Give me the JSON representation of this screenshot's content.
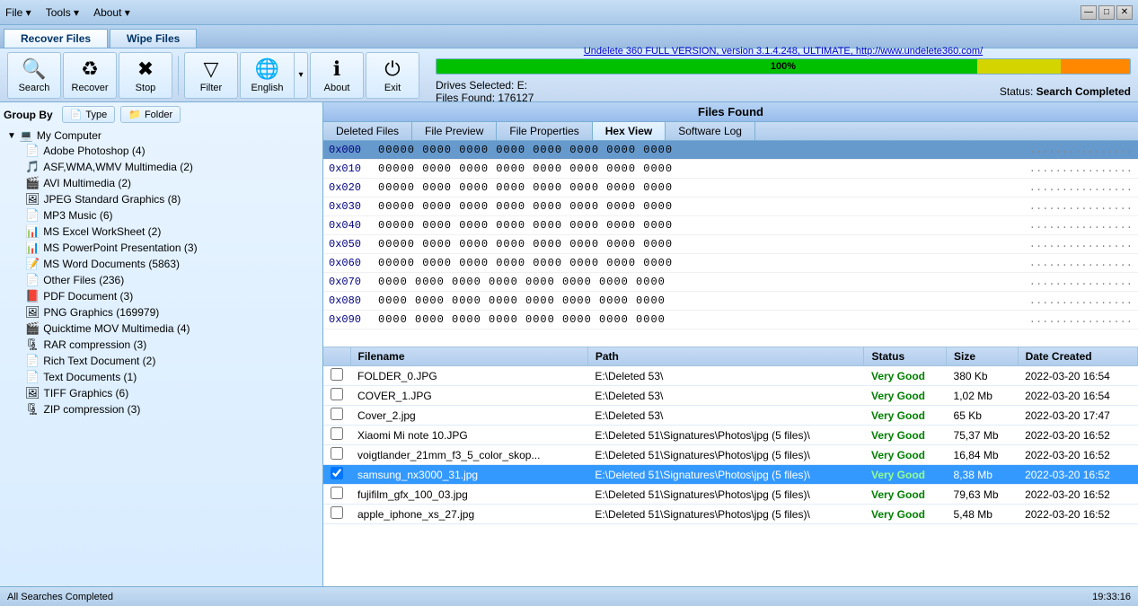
{
  "titlebar": {
    "menus": [
      {
        "label": "File",
        "has_arrow": true
      },
      {
        "label": "Tools",
        "has_arrow": true
      },
      {
        "label": "About",
        "has_arrow": true
      }
    ],
    "controls": [
      "—",
      "□",
      "✕"
    ]
  },
  "tabs": [
    {
      "label": "Recover Files",
      "active": true
    },
    {
      "label": "Wipe Files",
      "active": false
    }
  ],
  "toolbar": {
    "buttons": [
      {
        "label": "Search",
        "icon": "🔍"
      },
      {
        "label": "Recover",
        "icon": "♻"
      },
      {
        "label": "Stop",
        "icon": "✖"
      },
      {
        "label": "Filter",
        "icon": "▼"
      },
      {
        "label": "English",
        "icon": "🌐",
        "has_arrow": true
      },
      {
        "label": "About",
        "icon": "ℹ"
      },
      {
        "label": "Exit",
        "icon": "⏻"
      }
    ]
  },
  "app_link": "Undelete 360 FULL VERSION, version 3.1.4.248, ULTIMATE, http://www.undelete360.com/",
  "progress": {
    "value": 100,
    "label": "100%",
    "green_pct": 78,
    "yellow_pct": 12,
    "orange_pct": 10
  },
  "drive_status": {
    "drives": "Drives Selected: E:",
    "files_found": "Files Found: 176127",
    "status": "Status:",
    "status_value": "Search Completed"
  },
  "files_found_header": "Files Found",
  "view_tabs": [
    {
      "label": "Deleted Files",
      "active": false
    },
    {
      "label": "File Preview",
      "active": false
    },
    {
      "label": "File Properties",
      "active": false
    },
    {
      "label": "Hex View",
      "active": true
    },
    {
      "label": "Software Log",
      "active": false
    }
  ],
  "hex_rows": [
    {
      "addr": "0x000",
      "bytes": "00000 0000 0000 0000 0000 0000 0000 0000",
      "ascii": "................",
      "selected": true
    },
    {
      "addr": "0x010",
      "bytes": "00000 0000 0000 0000 0000 0000 0000 0000",
      "ascii": "................"
    },
    {
      "addr": "0x020",
      "bytes": "00000 0000 0000 0000 0000 0000 0000 0000",
      "ascii": "................"
    },
    {
      "addr": "0x030",
      "bytes": "00000 0000 0000 0000 0000 0000 0000 0000",
      "ascii": "................"
    },
    {
      "addr": "0x040",
      "bytes": "00000 0000 0000 0000 0000 0000 0000 0000",
      "ascii": "................"
    },
    {
      "addr": "0x050",
      "bytes": "00000 0000 0000 0000 0000 0000 0000 0000",
      "ascii": "................"
    },
    {
      "addr": "0x060",
      "bytes": "00000 0000 0000 0000 0000 0000 0000 0000",
      "ascii": "................"
    },
    {
      "addr": "0x070",
      "bytes": "0000 0000 0000 0000 0000 0000 0000 0000",
      "ascii": "................"
    },
    {
      "addr": "0x080",
      "bytes": "0000 0000 0000 0000 0000 0000 0000 0000",
      "ascii": "................"
    },
    {
      "addr": "0x090",
      "bytes": "0000 0000 0000 0000 0000 0000 0000 0000",
      "ascii": "................"
    }
  ],
  "table": {
    "columns": [
      "Filename",
      "Path",
      "Status",
      "Size",
      "Date Created"
    ],
    "rows": [
      {
        "checked": false,
        "filename": "FOLDER_0.JPG",
        "path": "E:\\Deleted 53\\",
        "status": "Very Good",
        "size": "380 Kb",
        "date": "2022-03-20 16:54",
        "selected": false
      },
      {
        "checked": false,
        "filename": "COVER_1.JPG",
        "path": "E:\\Deleted 53\\",
        "status": "Very Good",
        "size": "1,02 Mb",
        "date": "2022-03-20 16:54",
        "selected": false
      },
      {
        "checked": false,
        "filename": "Cover_2.jpg",
        "path": "E:\\Deleted 53\\",
        "status": "Very Good",
        "size": "65 Kb",
        "date": "2022-03-20 17:47",
        "selected": false
      },
      {
        "checked": false,
        "filename": "Xiaomi Mi note 10.JPG",
        "path": "E:\\Deleted 51\\Signatures\\Photos\\jpg (5 files)\\",
        "status": "Very Good",
        "size": "75,37 Mb",
        "date": "2022-03-20 16:52",
        "selected": false
      },
      {
        "checked": false,
        "filename": "voigtlander_21mm_f3_5_color_skop...",
        "path": "E:\\Deleted 51\\Signatures\\Photos\\jpg (5 files)\\",
        "status": "Very Good",
        "size": "16,84 Mb",
        "date": "2022-03-20 16:52",
        "selected": false
      },
      {
        "checked": true,
        "filename": "samsung_nx3000_31.jpg",
        "path": "E:\\Deleted 51\\Signatures\\Photos\\jpg (5 files)\\",
        "status": "Very Good",
        "size": "8,38 Mb",
        "date": "2022-03-20 16:52",
        "selected": true
      },
      {
        "checked": false,
        "filename": "fujifilm_gfx_100_03.jpg",
        "path": "E:\\Deleted 51\\Signatures\\Photos\\jpg (5 files)\\",
        "status": "Very Good",
        "size": "79,63 Mb",
        "date": "2022-03-20 16:52",
        "selected": false
      },
      {
        "checked": false,
        "filename": "apple_iphone_xs_27.jpg",
        "path": "E:\\Deleted 51\\Signatures\\Photos\\jpg (5 files)\\",
        "status": "Very Good",
        "size": "5,48 Mb",
        "date": "2022-03-20 16:52",
        "selected": false
      }
    ]
  },
  "sidebar": {
    "group_by": "Group By",
    "type_btn": "Type",
    "folder_btn": "Folder",
    "tree": {
      "root": "My Computer",
      "items": [
        {
          "label": "Adobe Photoshop (4)",
          "icon": "📄",
          "color": "#003399"
        },
        {
          "label": "ASF,WMA,WMV Multimedia (2)",
          "icon": "🎵",
          "color": "#333"
        },
        {
          "label": "AVI Multimedia (2)",
          "icon": "🎬",
          "color": "#333"
        },
        {
          "label": "JPEG Standard Graphics (8)",
          "icon": "🖼",
          "color": "#333"
        },
        {
          "label": "MP3 Music (6)",
          "icon": "📄",
          "color": "#333"
        },
        {
          "label": "MS Excel WorkSheet (2)",
          "icon": "📊",
          "color": "#008000"
        },
        {
          "label": "MS PowerPoint Presentation (3)",
          "icon": "📊",
          "color": "#cc4400"
        },
        {
          "label": "MS Word Documents (5863)",
          "icon": "📝",
          "color": "#0000cc"
        },
        {
          "label": "Other Files (236)",
          "icon": "📄",
          "color": "#666"
        },
        {
          "label": "PDF Document (3)",
          "icon": "📕",
          "color": "#cc0000"
        },
        {
          "label": "PNG Graphics (169979)",
          "icon": "🖼",
          "color": "#cc8800"
        },
        {
          "label": "Quicktime MOV Multimedia (4)",
          "icon": "🎬",
          "color": "#333"
        },
        {
          "label": "RAR compression (3)",
          "icon": "🗜",
          "color": "#333"
        },
        {
          "label": "Rich Text Document (2)",
          "icon": "📄",
          "color": "#333"
        },
        {
          "label": "Text Documents (1)",
          "icon": "📄",
          "color": "#333"
        },
        {
          "label": "TIFF Graphics (6)",
          "icon": "🖼",
          "color": "#333"
        },
        {
          "label": "ZIP compression (3)",
          "icon": "🗜",
          "color": "#333"
        }
      ]
    }
  },
  "statusbar": {
    "left": "All Searches Completed",
    "right": "19:33:16"
  }
}
